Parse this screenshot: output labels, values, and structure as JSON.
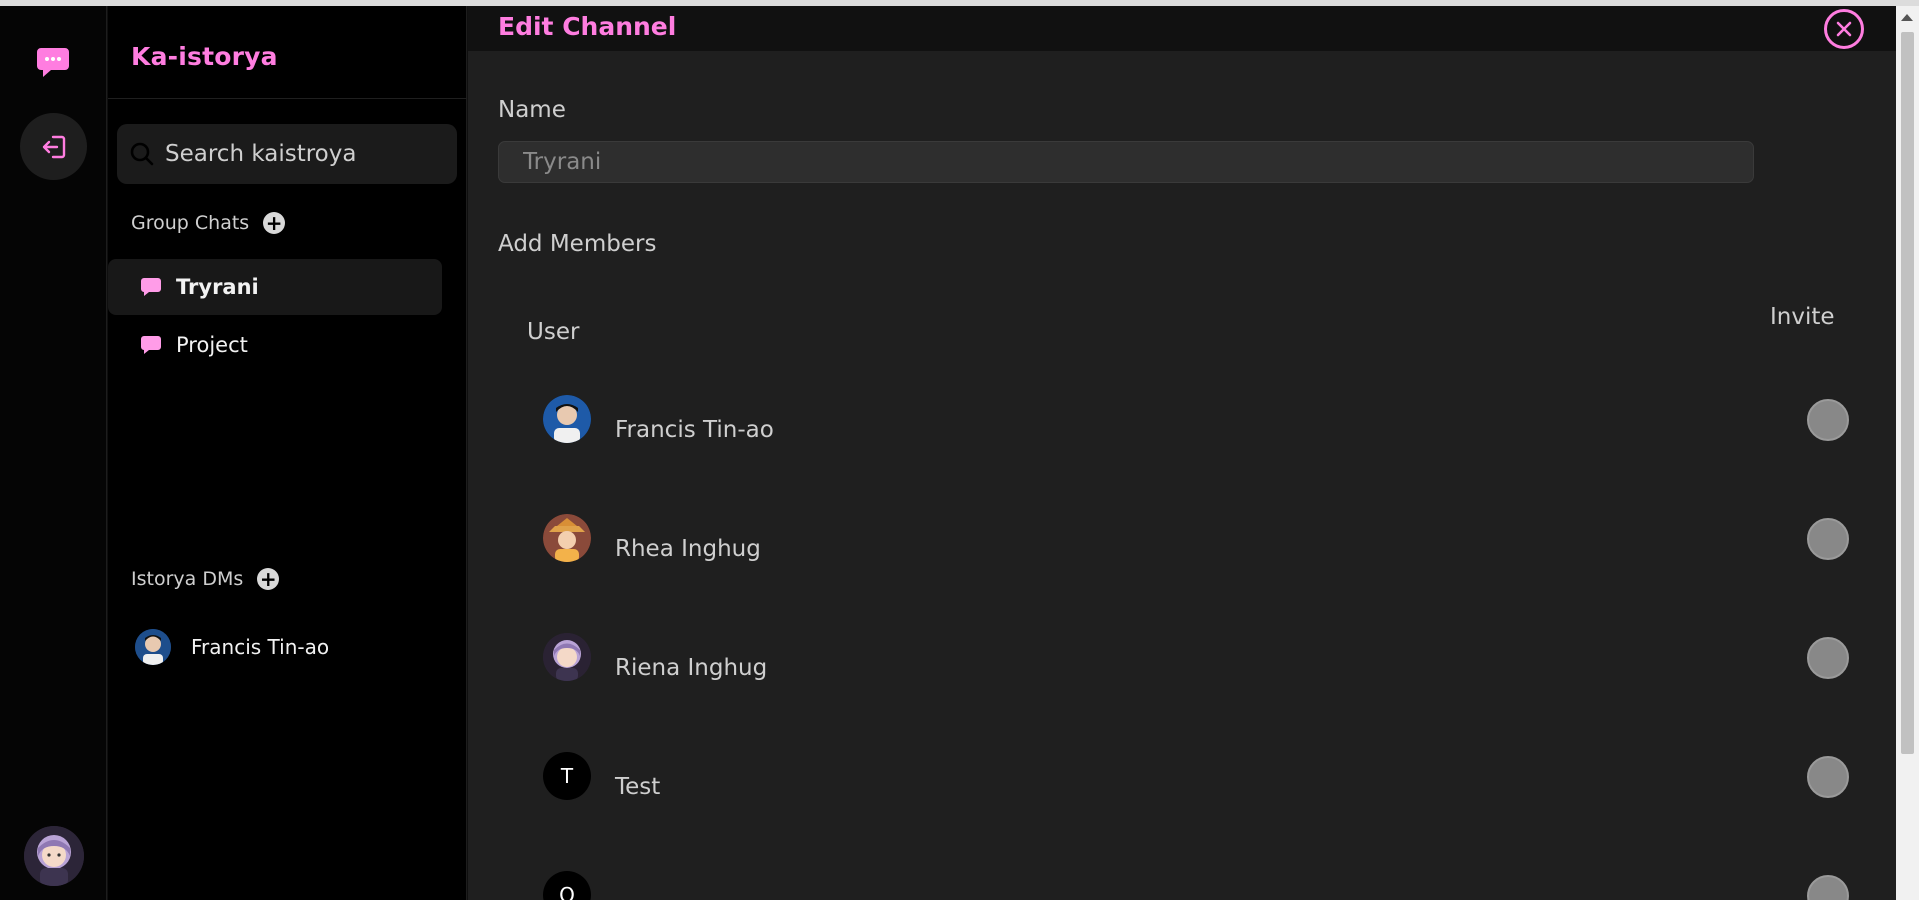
{
  "app": {
    "brand": "Ka-istorya",
    "accent": "#ff7de0"
  },
  "search": {
    "placeholder": "Search kaistroya"
  },
  "sidebar": {
    "group_chats_label": "Group Chats",
    "group_chats": [
      {
        "label": "Tryrani",
        "active": true
      },
      {
        "label": "Project",
        "active": false
      }
    ],
    "dms_label": "Istorya DMs",
    "dms": [
      {
        "label": "Francis Tin-ao"
      }
    ]
  },
  "modal": {
    "title": "Edit Channel",
    "name_label": "Name",
    "name_value": "Tryrani",
    "add_members_label": "Add Members",
    "col_user": "User",
    "col_invite": "Invite",
    "members": [
      {
        "name": "Francis Tin-ao",
        "avatar": "photo"
      },
      {
        "name": "Rhea Inghug",
        "avatar": "cowgirl"
      },
      {
        "name": "Riena Inghug",
        "avatar": "cartoon"
      },
      {
        "name": "Test",
        "avatar": "T"
      },
      {
        "name": "",
        "avatar": "O"
      }
    ]
  },
  "icons": [
    "chat-bubble-icon",
    "logout-icon",
    "search-icon",
    "plus-icon",
    "close-icon"
  ]
}
